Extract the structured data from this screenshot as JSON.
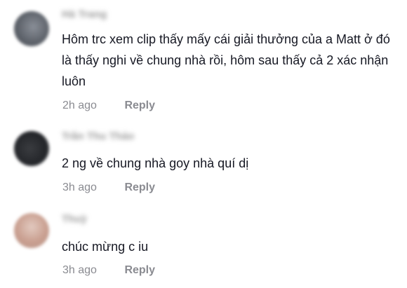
{
  "comments": [
    {
      "username": "Hà Trang",
      "text": "Hôm trc xem clip thấy mấy cái giải thưởng của a Matt ở đó là thấy nghi về chung nhà rồi, hôm sau thấy cả 2 xác nhận luôn",
      "timestamp": "2h ago",
      "reply_label": "Reply"
    },
    {
      "username": "Trần Thu Thảo",
      "text": "2 ng về chung nhà goy nhà quí dị",
      "timestamp": "3h ago",
      "reply_label": "Reply"
    },
    {
      "username": "Thuỳ",
      "text": "chúc mừng c iu",
      "timestamp": "3h ago",
      "reply_label": "Reply"
    }
  ]
}
